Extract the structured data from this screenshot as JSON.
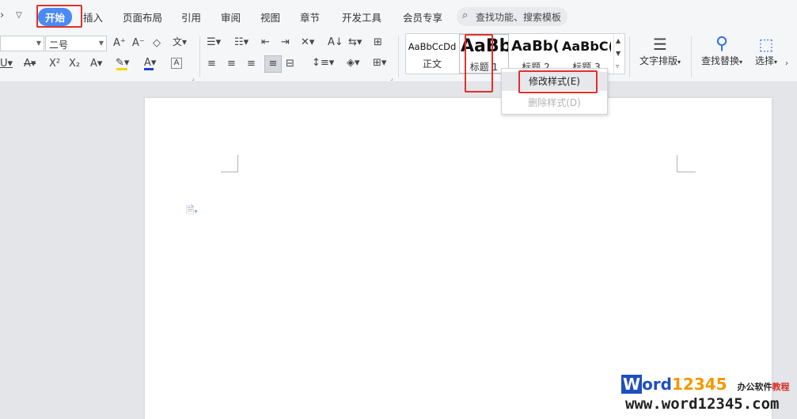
{
  "tabs": [
    {
      "label": "开始"
    },
    {
      "label": "插入"
    },
    {
      "label": "页面布局"
    },
    {
      "label": "引用"
    },
    {
      "label": "审阅"
    },
    {
      "label": "视图"
    },
    {
      "label": "章节"
    },
    {
      "label": "开发工具"
    },
    {
      "label": "会员专享"
    }
  ],
  "search": {
    "label": "查找功能、搜索模板"
  },
  "font": {
    "size_value": "二号"
  },
  "styles": [
    {
      "preview": "AaBbCcDd",
      "name": "正文"
    },
    {
      "preview": "AaBb",
      "name": "标题 1"
    },
    {
      "preview": "AaBb(",
      "name": "标题 2"
    },
    {
      "preview": "AaBbC(",
      "name": "标题 3"
    }
  ],
  "big_buttons": {
    "text_layout": "文字排版",
    "find_replace": "查找替换",
    "select": "选择"
  },
  "context_menu": {
    "modify_style": "修改样式(E)",
    "delete_style": "删除样式(D)"
  },
  "watermark": {
    "brand_w": "W",
    "brand_ord": "ord",
    "brand_digits": "12345",
    "tagline": "办公软件",
    "tagline2": "教程",
    "url": "www.word12345.com"
  },
  "colors": {
    "accent": "#4a8af4",
    "highlight_box": "#e0302d",
    "font_color_bar": "#d93025",
    "highlighter_bar": "#f5d800",
    "watermark_blue": "#1f4fbf",
    "watermark_orange": "#f39800"
  }
}
